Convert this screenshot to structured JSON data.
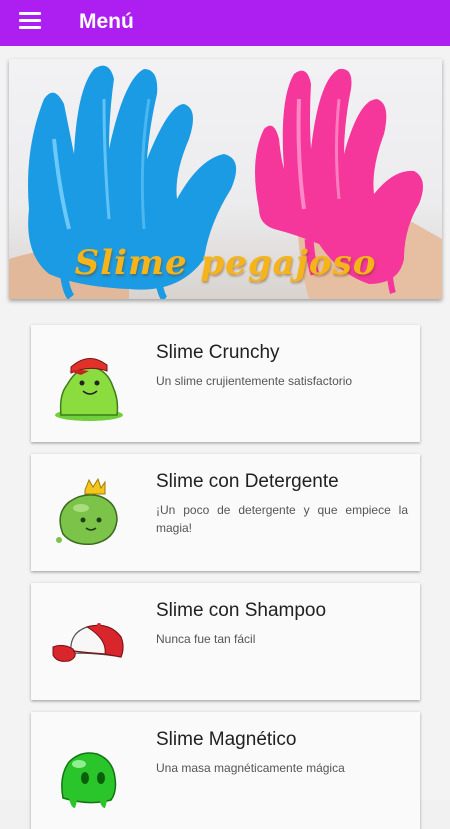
{
  "appbar": {
    "title": "Menú",
    "icon": "hamburger-menu-icon",
    "color": "#AD1FF1"
  },
  "banner": {
    "text": "Slime pegajoso"
  },
  "cards": [
    {
      "title": "Slime Crunchy",
      "description": "Un slime crujientemente satisfactorio",
      "icon": "green-slime-cap-icon"
    },
    {
      "title": "Slime con Detergente",
      "description": "¡Un poco de detergente y que empiece la magia!",
      "icon": "slime-crown-icon"
    },
    {
      "title": "Slime con Shampoo",
      "description": "Nunca fue tan fácil",
      "icon": "baseball-cap-icon"
    },
    {
      "title": "Slime Magnético",
      "description": "Una masa magnéticamente mágica",
      "icon": "magnetic-slime-icon"
    }
  ]
}
